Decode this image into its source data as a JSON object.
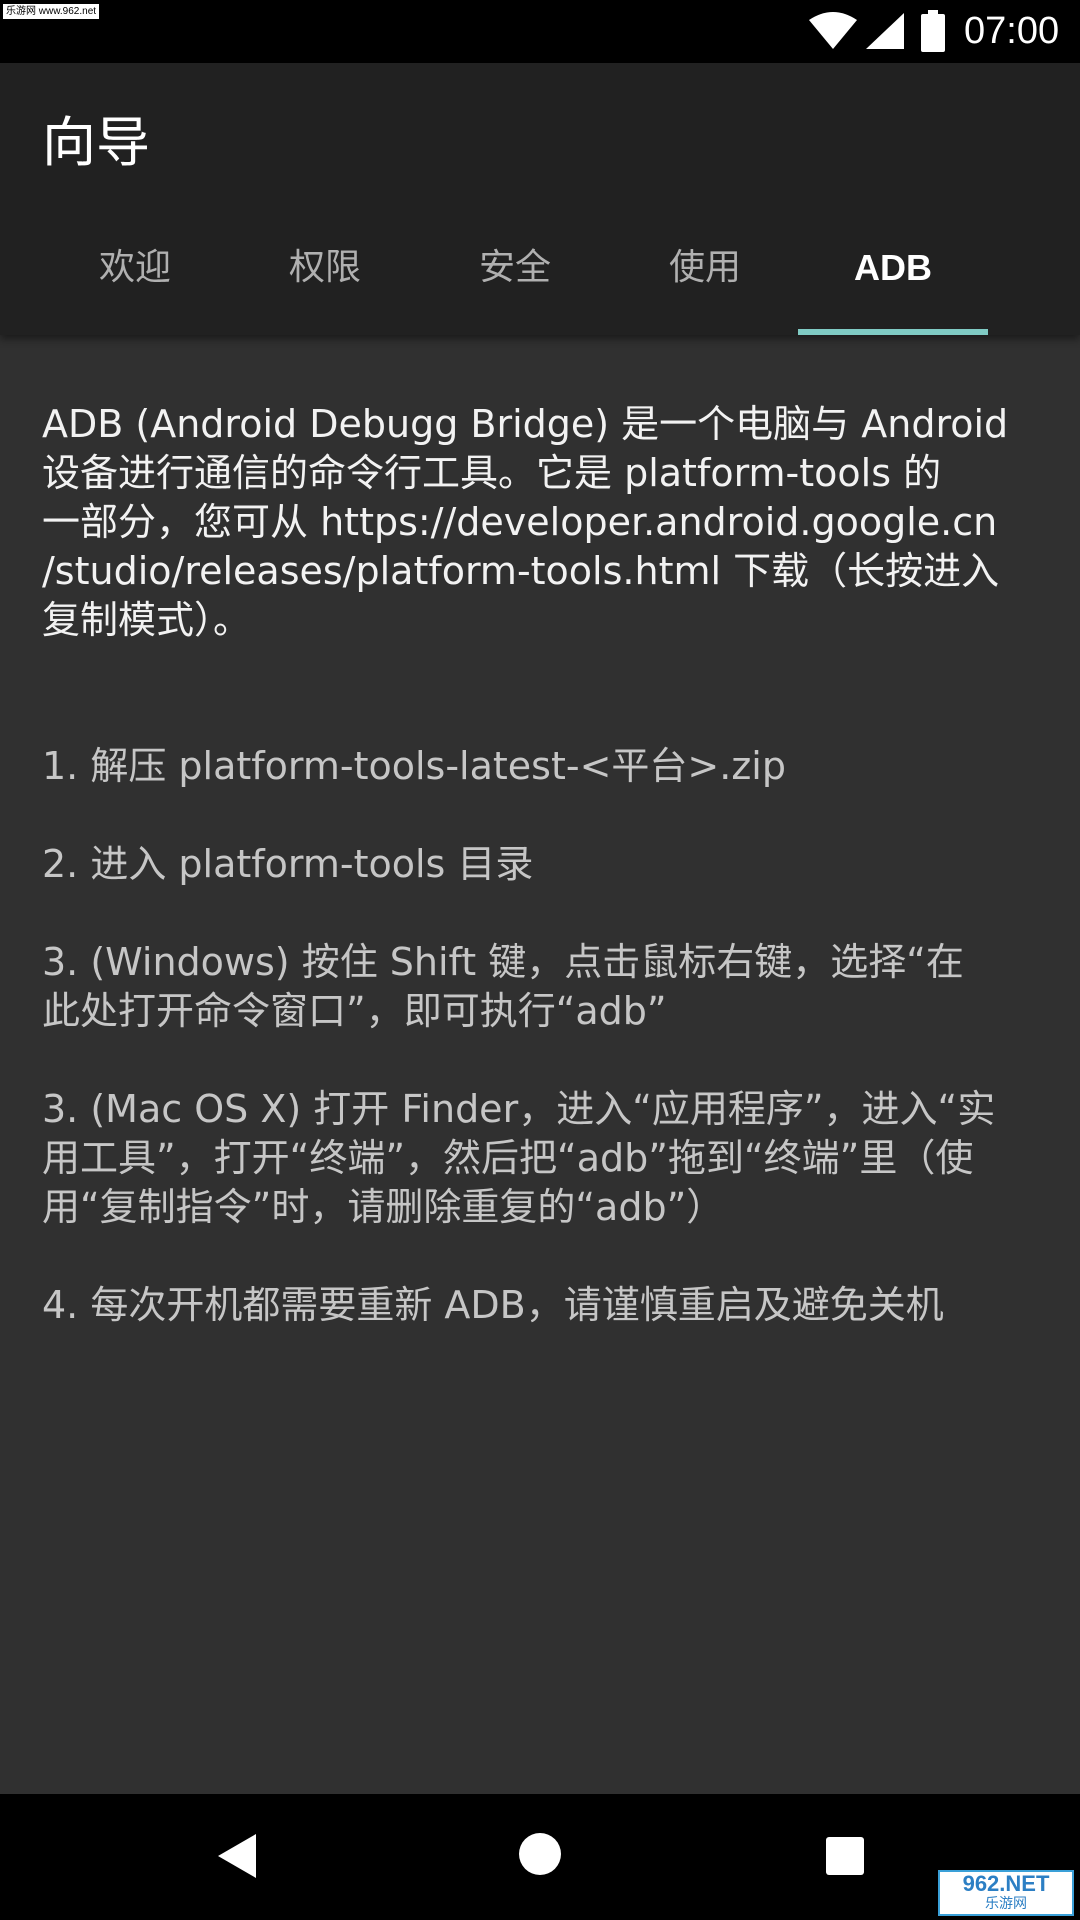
{
  "status_bar": {
    "time": "07:00",
    "watermark": "乐游网 www.962.net",
    "icons": [
      "wifi-icon",
      "signal-icon",
      "battery-icon"
    ]
  },
  "app_bar": {
    "title": "向导",
    "tabs": [
      {
        "label": "欢迎",
        "active": false
      },
      {
        "label": "权限",
        "active": false
      },
      {
        "label": "安全",
        "active": false
      },
      {
        "label": "使用",
        "active": false
      },
      {
        "label": "ADB",
        "active": true
      }
    ],
    "indicator_color": "#80cbc4"
  },
  "content": {
    "intro_lines": [
      "ADB (Android Debugg Bridge) 是一个电脑与 Android",
      "设备进行通信的命令行工具。它是 platform-tools 的",
      "一部分，您可从 https://developer.android.google.cn",
      "/studio/releases/platform-tools.html 下载（长按进入",
      "复制模式）。"
    ],
    "steps": [
      {
        "lines": [
          "1. 解压 platform-tools-latest-<平台>.zip"
        ]
      },
      {
        "lines": [
          "2. 进入 platform-tools 目录"
        ]
      },
      {
        "lines": [
          "3. (Windows) 按住 Shift 键，点击鼠标右键，选择“在",
          "此处打开命令窗口”，即可执行“adb”"
        ]
      },
      {
        "lines": [
          "3. (Mac OS X) 打开 Finder，进入“应用程序”，进入“实",
          "用工具”，打开“终端”，然后把“adb”拖到“终端”里（使",
          "用“复制指令”时，请删除重复的“adb”）"
        ]
      },
      {
        "lines": [
          "4. 每次开机都需要重新 ADB，请谨慎重启及避免关机"
        ]
      }
    ]
  },
  "nav_bar": {
    "buttons": [
      "back-icon",
      "home-icon",
      "recents-icon"
    ],
    "watermark_main": "962.NET",
    "watermark_sub": "乐游网"
  },
  "colors": {
    "status_bar": "#000000",
    "app_bar": "#212121",
    "background": "#303030",
    "text_primary": "#f2f2f2",
    "text_secondary": "#c6c6c6",
    "tab_inactive": "#b0b0b0"
  }
}
